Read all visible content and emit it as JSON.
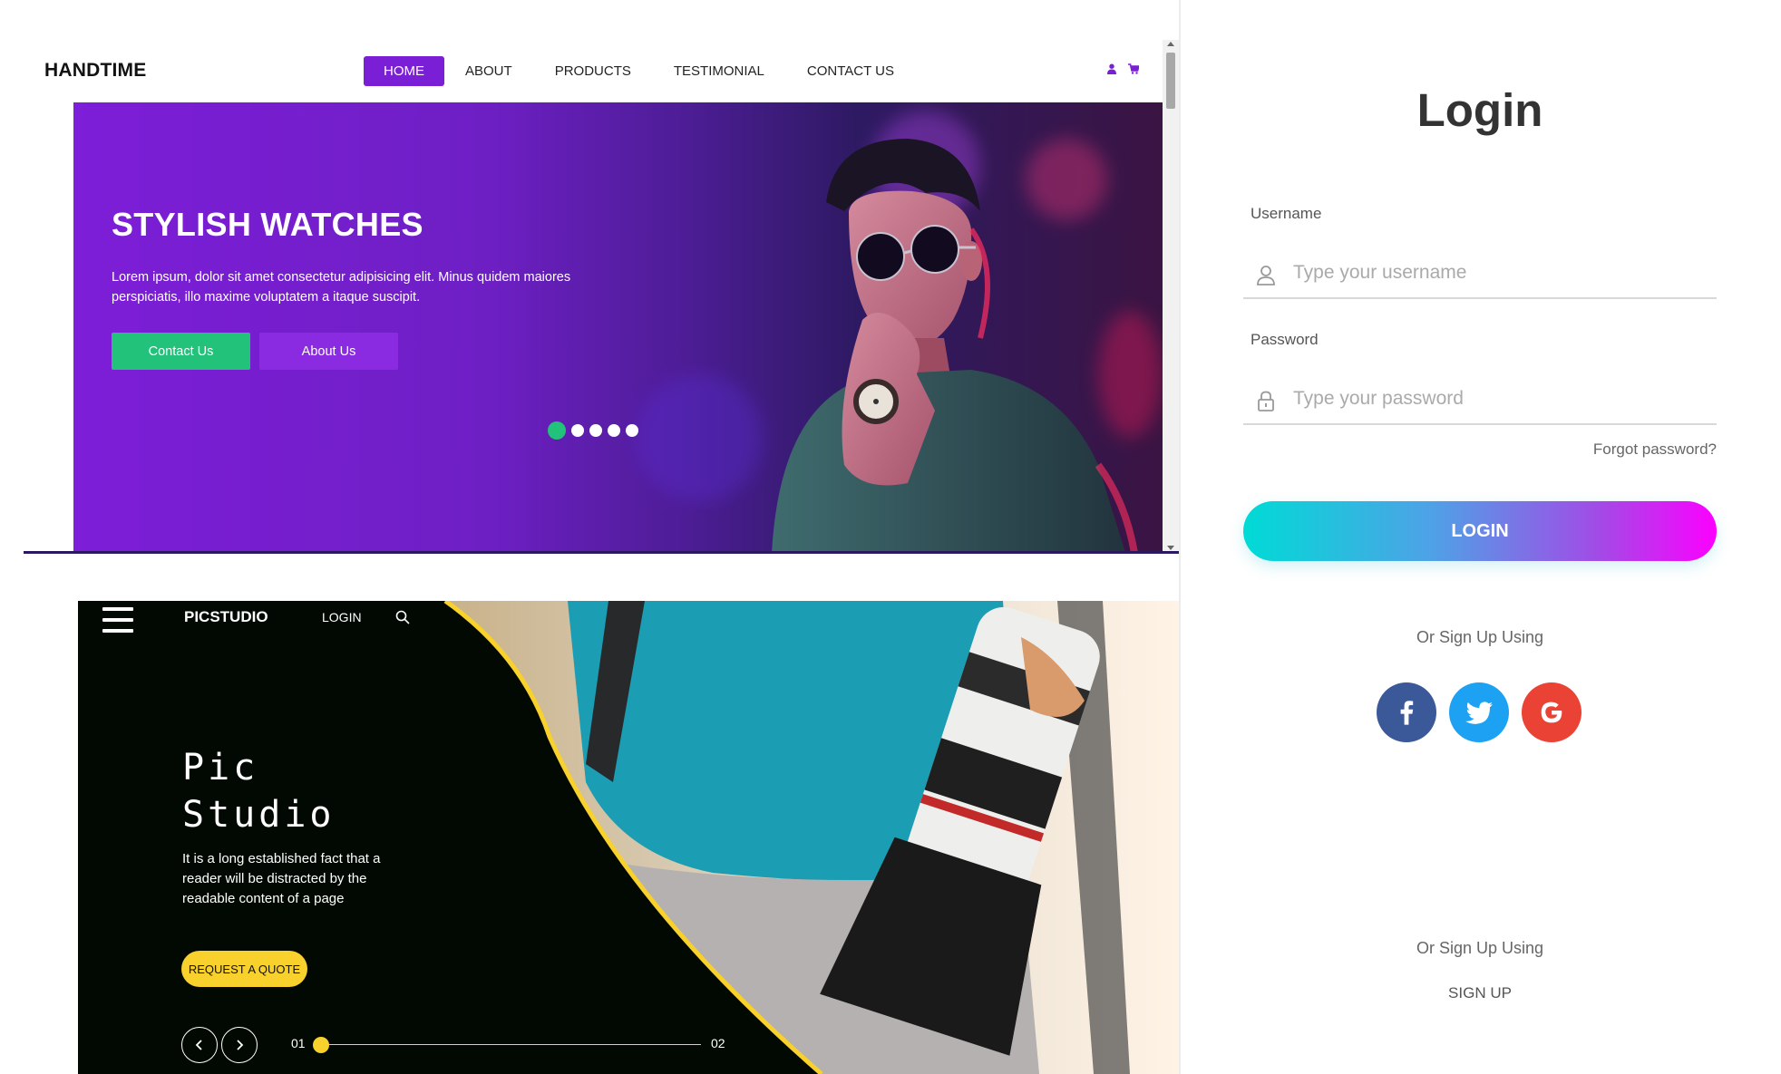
{
  "handtime": {
    "brand": "HANDTIME",
    "nav": [
      "HOME",
      "ABOUT",
      "PRODUCTS",
      "TESTIMONIAL",
      "CONTACT US"
    ],
    "icons": [
      "user-icon",
      "cart-icon"
    ],
    "hero": {
      "title": "STYLISH WATCHES",
      "text": "Lorem ipsum, dolor sit amet consectetur adipisicing elit. Minus quidem maiores perspiciatis, illo maxime voluptatem a itaque suscipit.",
      "btn_contact": "Contact Us",
      "btn_about": "About Us",
      "slides": 5,
      "active_slide": 1
    },
    "colors": {
      "accent": "#7a1fd6",
      "green": "#22c27a"
    }
  },
  "picstudio": {
    "logo": "PICSTUDIO",
    "login": "LOGIN",
    "title_line1": "Pic",
    "title_line2": "Studio",
    "description": "It is a long established fact that a reader will be distracted by the readable content of a page",
    "quote_button": "REQUEST A QUOTE",
    "slider_start": "01",
    "slider_end": "02",
    "colors": {
      "accent": "#f8d12c",
      "background": "#020902"
    }
  },
  "login_form": {
    "title": "Login",
    "username_label": "Username",
    "username_placeholder": "Type your username",
    "password_label": "Password",
    "password_placeholder": "Type your password",
    "forgot": "Forgot password?",
    "login_button": "LOGIN",
    "or_sign_up_1": "Or Sign Up Using",
    "or_sign_up_2": "Or Sign Up Using",
    "sign_up": "SIGN UP",
    "social": [
      "facebook-icon",
      "twitter-icon",
      "google-icon"
    ],
    "colors": {
      "facebook": "#3b5998",
      "twitter": "#1da1f2",
      "google": "#ea4335"
    }
  }
}
